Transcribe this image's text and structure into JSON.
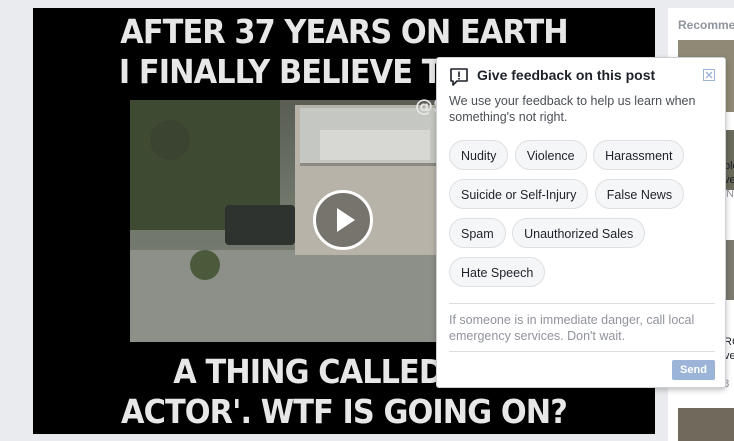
{
  "video": {
    "top_caption_line1": "AFTER 37 YEARS ON EARTH",
    "top_caption_line2": "I FINALLY BELIEVE THERE IS",
    "watermark": "@S",
    "bottom_caption_line1": "A THING CALLED A 'C",
    "bottom_caption_line2": "ACTOR'. WTF IS GOING ON?"
  },
  "sidebar": {
    "heading": "Recomme",
    "snippets": [
      "ple",
      "ve",
      "N",
      "RC",
      "ve",
      "3,8"
    ]
  },
  "feedback": {
    "title": "Give feedback on this post",
    "description": "We use your feedback to help us learn when something's not right.",
    "options": [
      "Nudity",
      "Violence",
      "Harassment",
      "Suicide or Self-Injury",
      "False News",
      "Spam",
      "Unauthorized Sales",
      "Hate Speech"
    ],
    "danger_note": "If someone is in immediate danger, call local emergency services. Don't wait.",
    "send_label": "Send",
    "accent_color": "#9cb4d8"
  }
}
